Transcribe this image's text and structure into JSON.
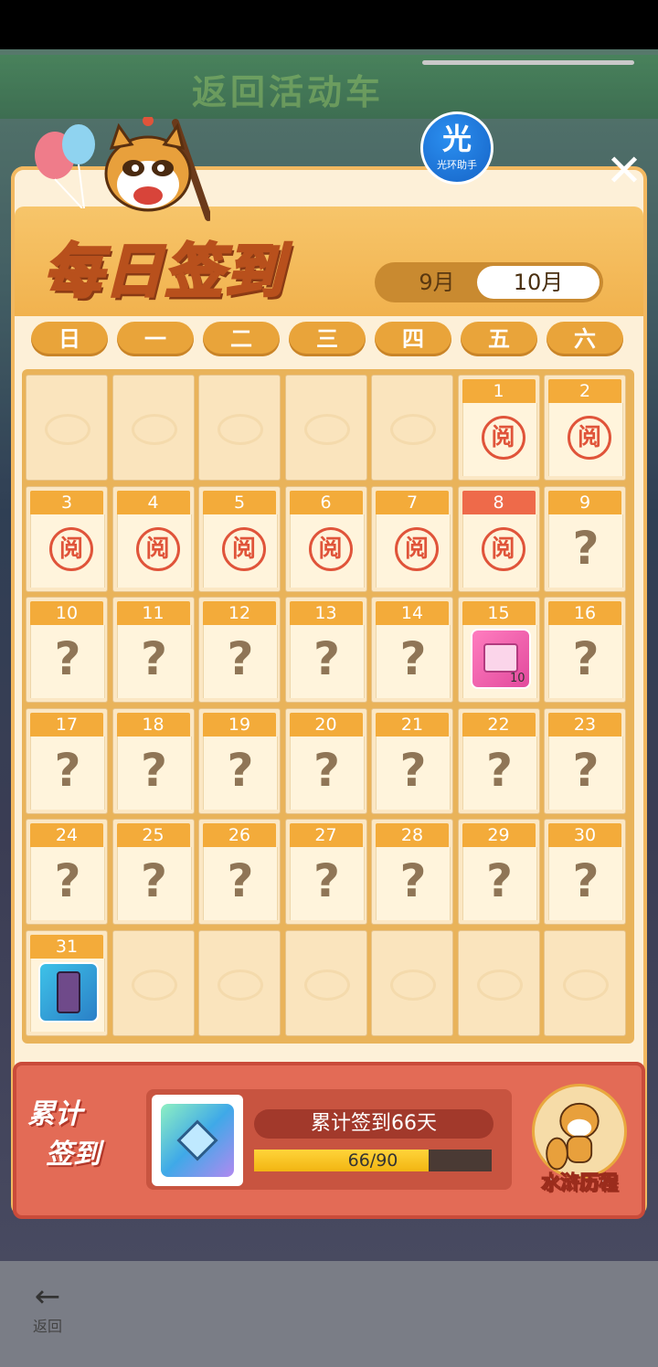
{
  "background": {
    "banner_text": "返回活动车",
    "back_label": "返回"
  },
  "assistant": {
    "glyph": "光",
    "caption": "光环助手"
  },
  "close_icon": "close-icon",
  "title": "每日签到",
  "months": {
    "prev": "9月",
    "current": "10月"
  },
  "weekdays": [
    "日",
    "一",
    "二",
    "三",
    "四",
    "五",
    "六"
  ],
  "calendar": {
    "leading_empty": 5,
    "trailing_empty": 6,
    "today": 8,
    "stamp_glyph": "阅",
    "question_glyph": "?",
    "days": [
      {
        "day": "1",
        "state": "signed"
      },
      {
        "day": "2",
        "state": "signed"
      },
      {
        "day": "3",
        "state": "signed"
      },
      {
        "day": "4",
        "state": "signed"
      },
      {
        "day": "5",
        "state": "signed"
      },
      {
        "day": "6",
        "state": "signed"
      },
      {
        "day": "7",
        "state": "signed"
      },
      {
        "day": "8",
        "state": "signed"
      },
      {
        "day": "9",
        "state": "unknown"
      },
      {
        "day": "10",
        "state": "unknown"
      },
      {
        "day": "11",
        "state": "unknown"
      },
      {
        "day": "12",
        "state": "unknown"
      },
      {
        "day": "13",
        "state": "unknown"
      },
      {
        "day": "14",
        "state": "unknown"
      },
      {
        "day": "15",
        "state": "reward",
        "item": "ticket",
        "qty": "10"
      },
      {
        "day": "16",
        "state": "unknown"
      },
      {
        "day": "17",
        "state": "unknown"
      },
      {
        "day": "18",
        "state": "unknown"
      },
      {
        "day": "19",
        "state": "unknown"
      },
      {
        "day": "20",
        "state": "unknown"
      },
      {
        "day": "21",
        "state": "unknown"
      },
      {
        "day": "22",
        "state": "unknown"
      },
      {
        "day": "23",
        "state": "unknown"
      },
      {
        "day": "24",
        "state": "unknown"
      },
      {
        "day": "25",
        "state": "unknown"
      },
      {
        "day": "26",
        "state": "unknown"
      },
      {
        "day": "27",
        "state": "unknown"
      },
      {
        "day": "28",
        "state": "unknown"
      },
      {
        "day": "29",
        "state": "unknown"
      },
      {
        "day": "30",
        "state": "unknown"
      },
      {
        "day": "31",
        "state": "reward",
        "item": "hourglass",
        "qty": ""
      }
    ]
  },
  "cumulative": {
    "label_line1": "累计",
    "label_line2": "签到",
    "title": "累计签到66天",
    "progress_text": "66/90",
    "progress_fraction": 0.733
  },
  "journey": {
    "label": "水浒历程"
  }
}
